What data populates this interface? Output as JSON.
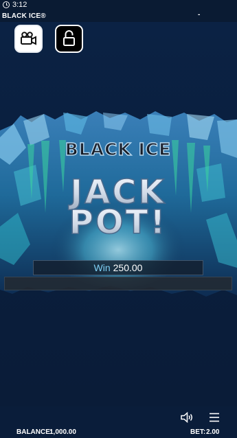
{
  "status_bar": {
    "time": "3:12"
  },
  "app": {
    "title": "BLACK ICE®",
    "title_right": "-"
  },
  "banner": {
    "logo_text": "BLACK ICE",
    "jackpot_line1": "JACK",
    "jackpot_line2": "POT!"
  },
  "win": {
    "label": "Win",
    "amount": "250.00"
  },
  "footer": {
    "balance_label": "BALANCE:",
    "balance_value": "1,000.00",
    "bet_label": "BET:",
    "bet_value": "2.00"
  },
  "icons": {
    "camera": "video-camera-icon",
    "lock": "unlock-icon",
    "sound": "speaker-icon",
    "menu": "hamburger-menu-icon"
  },
  "colors": {
    "background": "#0b1f3c",
    "ice_cyan": "#4fd6ef",
    "ice_green": "#3bd6a0",
    "win_label": "#7fd0f5"
  }
}
